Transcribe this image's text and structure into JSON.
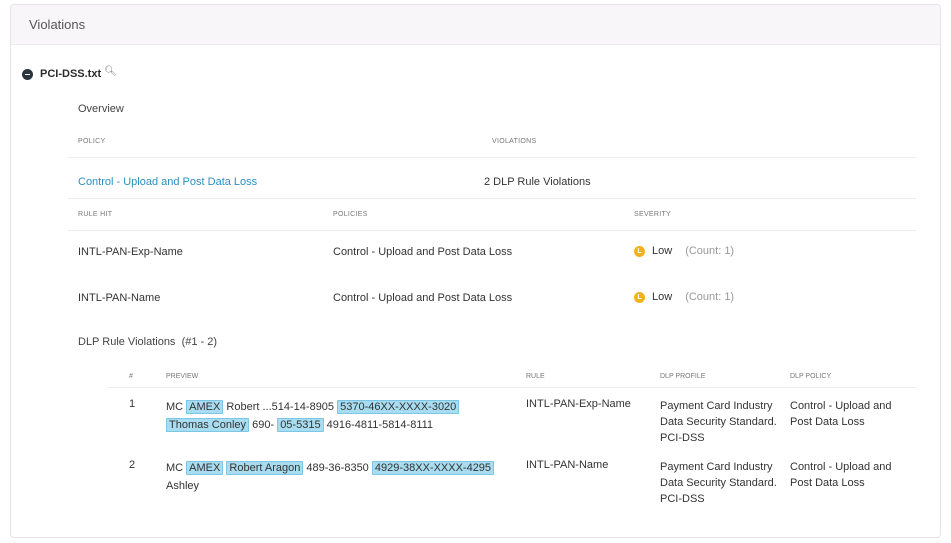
{
  "panel": {
    "title": "Violations"
  },
  "file": {
    "name": "PCI-DSS.txt",
    "collapse_icon": "minus-circle-icon",
    "zoom_icon": "zoom-in-icon"
  },
  "overview": {
    "title": "Overview"
  },
  "policy_table": {
    "headers": {
      "policy": "POLICY",
      "violations": "VIOLATIONS"
    },
    "row": {
      "policy": "Control - Upload and Post Data Loss",
      "violations": "2 DLP Rule Violations"
    }
  },
  "rules_table": {
    "headers": {
      "rule_hit": "RULE HIT",
      "policies": "POLICIES",
      "severity": "SEVERITY"
    },
    "rows": [
      {
        "rule": "INTL-PAN-Exp-Name",
        "policy": "Control - Upload and Post Data Loss",
        "severity": "Low",
        "count": "(Count: 1)",
        "sev_letter": "L"
      },
      {
        "rule": "INTL-PAN-Name",
        "policy": "Control - Upload and Post Data Loss",
        "severity": "Low",
        "count": "(Count: 1)",
        "sev_letter": "L"
      }
    ],
    "severity_color": "#f2b21b"
  },
  "dlp_violations": {
    "title": "DLP Rule Violations",
    "range": "(#1 - 2)",
    "headers": {
      "num": "#",
      "preview": "PREVIEW",
      "rule": "RULE",
      "profile": "DLP PROFILE",
      "policy": "DLP POLICY"
    },
    "rows": [
      {
        "num": "1",
        "preview": {
          "t1": "MC ",
          "h1": "AMEX",
          "t2": " Robert ...514-14-8905 ",
          "h2": "5370-46XX-XXXX-3020",
          "h3": "Thomas Conley",
          "t3": " 690- ",
          "h4": "05-5315",
          "t4": " 4916-4811-5814-8111"
        },
        "rule": "INTL-PAN-Exp-Name",
        "profile": "Payment Card Industry Data Security Standard. PCI-DSS",
        "policy": "Control - Upload and Post Data Loss"
      },
      {
        "num": "2",
        "preview": {
          "t1": "MC ",
          "h1": "AMEX",
          "t2": " ",
          "h2": "Robert Aragon",
          "t3": " 489-36-8350 ",
          "h3": "4929-38XX-XXXX-4295",
          "t4": "Ashley"
        },
        "rule": "INTL-PAN-Name",
        "profile": "Payment Card Industry Data Security Standard. PCI-DSS",
        "policy": "Control - Upload and Post Data Loss"
      }
    ],
    "highlight_color": "#a8dcf0"
  }
}
